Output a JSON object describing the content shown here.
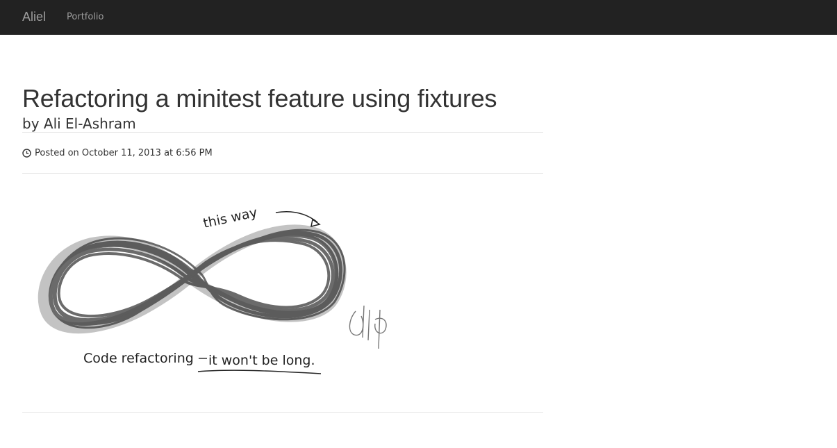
{
  "nav": {
    "brand": "Aliel",
    "links": [
      {
        "label": "Portfolio"
      }
    ]
  },
  "post": {
    "title": "Refactoring a minitest feature using fixtures",
    "author": "by Ali El-Ashram",
    "posted": "Posted on October 11, 2013 at 6:56 PM",
    "image": {
      "annotation": "this way",
      "caption_left": "Code refactoring",
      "caption_right": "it won't be long."
    }
  },
  "icons": {
    "clock": "clock-icon"
  },
  "colors": {
    "navbar": "#222222",
    "nav_text": "#9d9d9d",
    "divider": "#e6e6e6",
    "text": "#333333"
  }
}
